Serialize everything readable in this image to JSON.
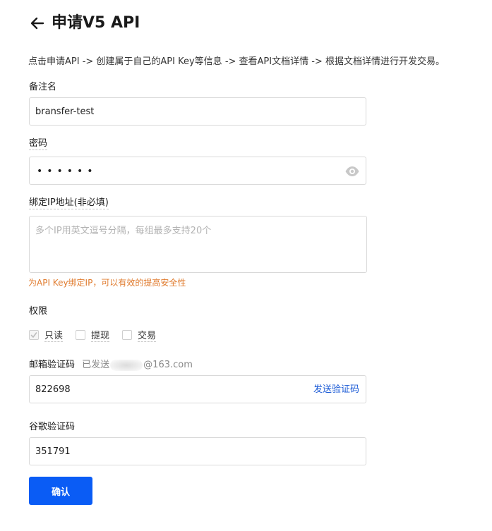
{
  "header": {
    "title": "申请V5 API",
    "back_icon": "arrow-left-icon"
  },
  "intro": "点击申请API -> 创建属于自己的API Key等信息 -> 查看API文档详情 -> 根据文档详情进行开发交易。",
  "form": {
    "remark": {
      "label": "备注名",
      "value": "bransfer-test"
    },
    "password": {
      "label": "密码",
      "masked_value": "••••••",
      "eye_icon": "eye-icon"
    },
    "ip_binding": {
      "label": "绑定IP地址(非必填)",
      "placeholder": "多个IP用英文逗号分隔，每组最多支持20个",
      "hint": "为API Key绑定IP，可以有效的提高安全性"
    },
    "permissions": {
      "label": "权限",
      "options": [
        {
          "label": "只读",
          "checked": true,
          "disabled": true
        },
        {
          "label": "提现",
          "checked": false
        },
        {
          "label": "交易",
          "checked": false
        }
      ]
    },
    "email_code": {
      "label": "邮箱验证码",
      "sent_prefix": "已发送",
      "sent_suffix": "@163.com",
      "value": "822698",
      "send_button": "发送验证码"
    },
    "google_code": {
      "label": "谷歌验证码",
      "value": "351791"
    },
    "submit": "确认"
  },
  "colors": {
    "primary": "#0a5cf5",
    "link": "#1a5ad6",
    "hint": "#e07b2e",
    "border": "#d9d9d9"
  }
}
